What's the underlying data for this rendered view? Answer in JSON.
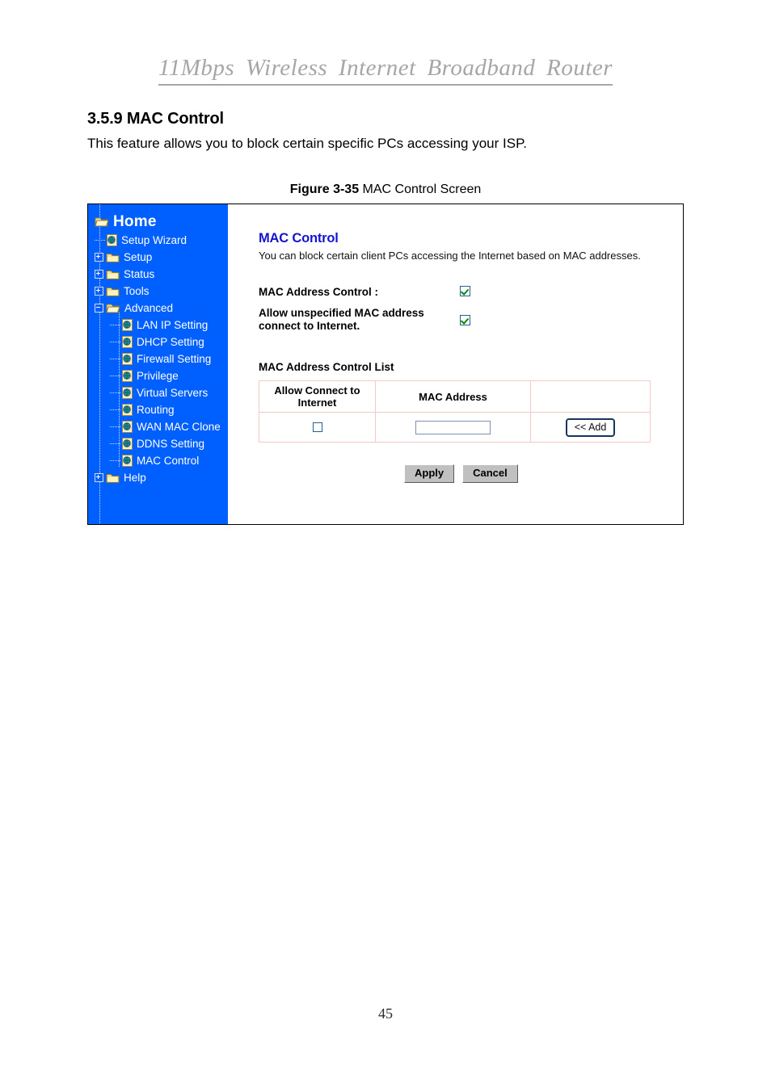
{
  "document": {
    "running_header": "11Mbps  Wireless  Internet  Broadband  Router",
    "section_number_title": "3.5.9 MAC Control",
    "section_body": "This feature allows you to block certain specific PCs accessing your ISP.",
    "figure_label": "Figure 3-35",
    "figure_caption": "MAC Control Screen",
    "page_number": "45"
  },
  "colors": {
    "sidebar_background": "#0060ff",
    "panel_title": "#1515cf",
    "table_border": "#f4c9c9",
    "checkbox_border": "#2b5f8f",
    "checkmark": "#008a00",
    "header_gray": "#a6a6a6",
    "button_face": "#c0c0c0",
    "add_button_border": "#16355f"
  },
  "sidebar": {
    "root": {
      "label": "Home",
      "icon": "open-folder-icon"
    },
    "items": [
      {
        "label": "Setup Wizard",
        "icon": "page-globe-icon",
        "level": 1,
        "expander": "none",
        "state": "leaf"
      },
      {
        "label": "Setup",
        "icon": "closed-folder-icon",
        "level": 1,
        "expander": "plus",
        "state": "collapsed"
      },
      {
        "label": "Status",
        "icon": "closed-folder-icon",
        "level": 1,
        "expander": "plus",
        "state": "collapsed"
      },
      {
        "label": "Tools",
        "icon": "closed-folder-icon",
        "level": 1,
        "expander": "plus",
        "state": "collapsed"
      },
      {
        "label": "Advanced",
        "icon": "open-folder-icon",
        "level": 1,
        "expander": "minus",
        "state": "expanded"
      },
      {
        "label": "LAN IP Setting",
        "icon": "page-globe-icon",
        "level": 2,
        "expander": "none",
        "state": "leaf"
      },
      {
        "label": "DHCP Setting",
        "icon": "page-globe-icon",
        "level": 2,
        "expander": "none",
        "state": "leaf"
      },
      {
        "label": "Firewall Setting",
        "icon": "page-globe-icon",
        "level": 2,
        "expander": "none",
        "state": "leaf"
      },
      {
        "label": "Privilege",
        "icon": "page-globe-icon",
        "level": 2,
        "expander": "none",
        "state": "leaf"
      },
      {
        "label": "Virtual Servers",
        "icon": "page-globe-icon",
        "level": 2,
        "expander": "none",
        "state": "leaf"
      },
      {
        "label": "Routing",
        "icon": "page-globe-icon",
        "level": 2,
        "expander": "none",
        "state": "leaf"
      },
      {
        "label": "WAN MAC Clone",
        "icon": "page-globe-icon",
        "level": 2,
        "expander": "none",
        "state": "leaf"
      },
      {
        "label": "DDNS Setting",
        "icon": "page-globe-icon",
        "level": 2,
        "expander": "none",
        "state": "leaf"
      },
      {
        "label": "MAC Control",
        "icon": "page-globe-icon",
        "level": 2,
        "expander": "none",
        "state": "leaf"
      },
      {
        "label": "Help",
        "icon": "closed-folder-icon",
        "level": 1,
        "expander": "plus",
        "state": "collapsed"
      }
    ]
  },
  "main_panel": {
    "title": "MAC Control",
    "description": "You can block certain client PCs accessing the Internet based on MAC addresses.",
    "fields": {
      "mac_address_control_label": "MAC Address Control :",
      "mac_address_control_checked": true,
      "allow_unspecified_label_line1": "Allow unspecified MAC address",
      "allow_unspecified_label_line2": "connect to Internet.",
      "allow_unspecified_checked": true
    },
    "list": {
      "title": "MAC Address Control List",
      "columns": [
        "Allow Connect to Internet",
        "MAC Address",
        ""
      ],
      "column_allow_line1": "Allow Connect to",
      "column_allow_line2": "Internet",
      "column_mac": "MAC Address",
      "column_action": "",
      "rows": [
        {
          "allow_checked": false,
          "mac_address": "",
          "mac_address_placeholder": "",
          "action_label": "<< Add"
        }
      ]
    },
    "buttons": {
      "apply": "Apply",
      "cancel": "Cancel"
    }
  }
}
